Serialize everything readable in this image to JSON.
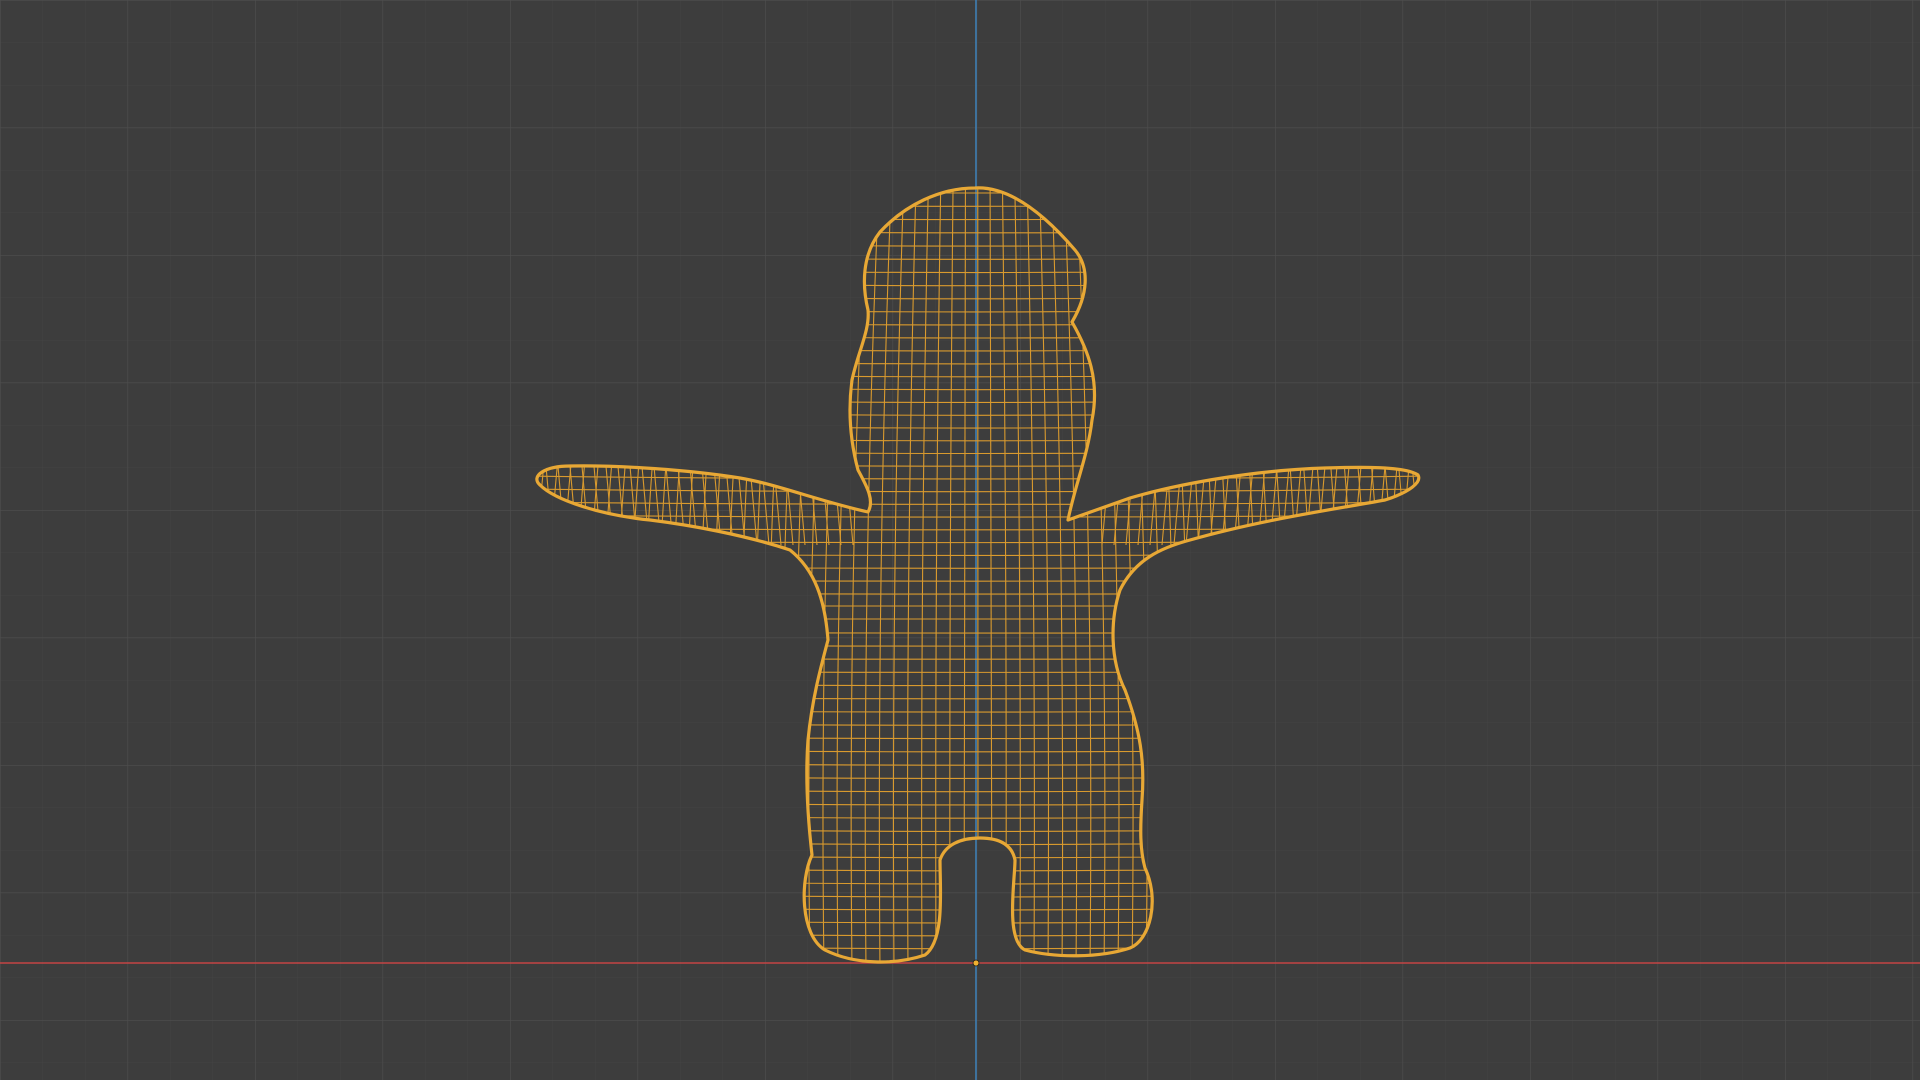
{
  "viewport": {
    "view": "front-orthographic",
    "shading": "wireframe",
    "background_color": "#3d3d3d",
    "grid_minor_color": "#434343",
    "grid_major_color": "#4d4d4d",
    "x_axis_color": "#c44545",
    "z_axis_color": "#3f7fb5",
    "object_origin_color": "#f0b030"
  },
  "selected_object": {
    "selected": true,
    "outline_color": "#e8a835",
    "wire_color": "#d99a2e",
    "parts": [
      "head",
      "torso",
      "left-arm",
      "right-arm",
      "left-leg",
      "right-leg"
    ]
  }
}
